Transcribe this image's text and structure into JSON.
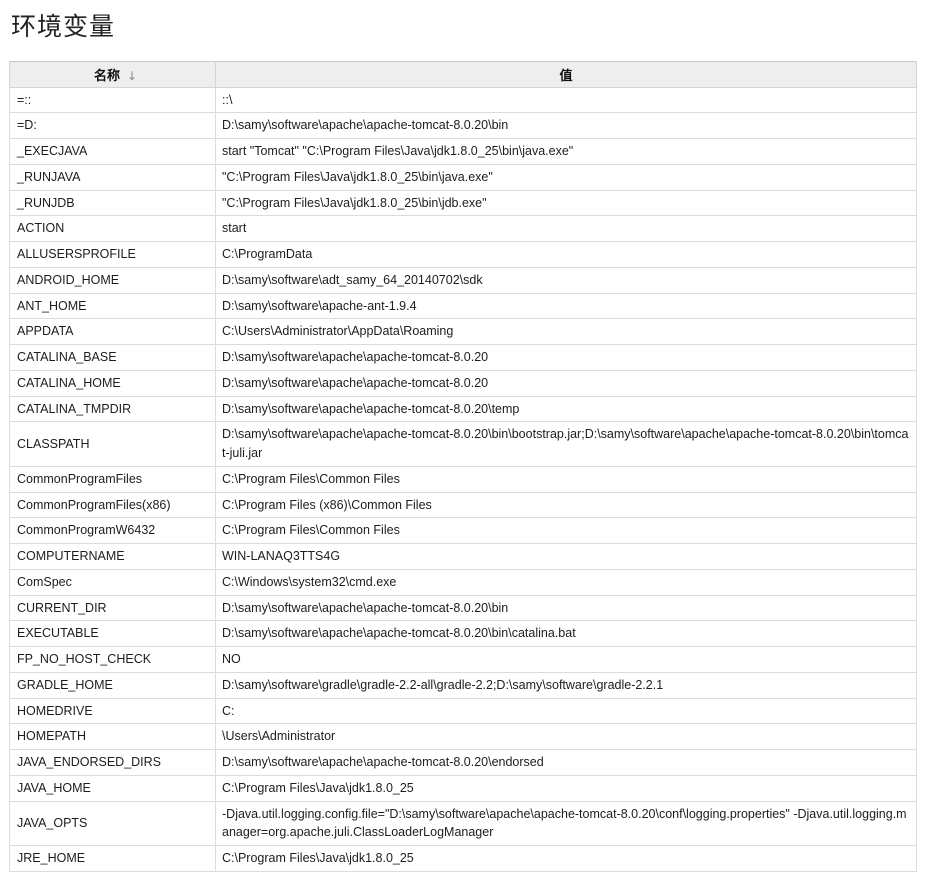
{
  "page": {
    "title": "环境变量"
  },
  "table": {
    "columns": [
      {
        "label": "名称",
        "sort_indicator": "↓",
        "sorted": true
      },
      {
        "label": "值",
        "sort_indicator": "",
        "sorted": false
      }
    ],
    "rows": [
      {
        "name": "=::",
        "value": "::\\"
      },
      {
        "name": "=D:",
        "value": "D:\\samy\\software\\apache\\apache-tomcat-8.0.20\\bin"
      },
      {
        "name": "_EXECJAVA",
        "value": "start \"Tomcat\" \"C:\\Program Files\\Java\\jdk1.8.0_25\\bin\\java.exe\""
      },
      {
        "name": "_RUNJAVA",
        "value": "\"C:\\Program Files\\Java\\jdk1.8.0_25\\bin\\java.exe\""
      },
      {
        "name": "_RUNJDB",
        "value": "\"C:\\Program Files\\Java\\jdk1.8.0_25\\bin\\jdb.exe\""
      },
      {
        "name": "ACTION",
        "value": "start"
      },
      {
        "name": "ALLUSERSPROFILE",
        "value": "C:\\ProgramData"
      },
      {
        "name": "ANDROID_HOME",
        "value": "D:\\samy\\software\\adt_samy_64_20140702\\sdk"
      },
      {
        "name": "ANT_HOME",
        "value": "D:\\samy\\software\\apache-ant-1.9.4"
      },
      {
        "name": "APPDATA",
        "value": "C:\\Users\\Administrator\\AppData\\Roaming"
      },
      {
        "name": "CATALINA_BASE",
        "value": "D:\\samy\\software\\apache\\apache-tomcat-8.0.20"
      },
      {
        "name": "CATALINA_HOME",
        "value": "D:\\samy\\software\\apache\\apache-tomcat-8.0.20"
      },
      {
        "name": "CATALINA_TMPDIR",
        "value": "D:\\samy\\software\\apache\\apache-tomcat-8.0.20\\temp"
      },
      {
        "name": "CLASSPATH",
        "value": "D:\\samy\\software\\apache\\apache-tomcat-8.0.20\\bin\\bootstrap.jar;D:\\samy\\software\\apache\\apache-tomcat-8.0.20\\bin\\tomcat-juli.jar"
      },
      {
        "name": "CommonProgramFiles",
        "value": "C:\\Program Files\\Common Files"
      },
      {
        "name": "CommonProgramFiles(x86)",
        "value": "C:\\Program Files (x86)\\Common Files"
      },
      {
        "name": "CommonProgramW6432",
        "value": "C:\\Program Files\\Common Files"
      },
      {
        "name": "COMPUTERNAME",
        "value": "WIN-LANAQ3TTS4G"
      },
      {
        "name": "ComSpec",
        "value": "C:\\Windows\\system32\\cmd.exe"
      },
      {
        "name": "CURRENT_DIR",
        "value": "D:\\samy\\software\\apache\\apache-tomcat-8.0.20\\bin"
      },
      {
        "name": "EXECUTABLE",
        "value": "D:\\samy\\software\\apache\\apache-tomcat-8.0.20\\bin\\catalina.bat"
      },
      {
        "name": "FP_NO_HOST_CHECK",
        "value": "NO"
      },
      {
        "name": "GRADLE_HOME",
        "value": "D:\\samy\\software\\gradle\\gradle-2.2-all\\gradle-2.2;D:\\samy\\software\\gradle-2.2.1"
      },
      {
        "name": "HOMEDRIVE",
        "value": "C:"
      },
      {
        "name": "HOMEPATH",
        "value": "\\Users\\Administrator"
      },
      {
        "name": "JAVA_ENDORSED_DIRS",
        "value": "D:\\samy\\software\\apache\\apache-tomcat-8.0.20\\endorsed"
      },
      {
        "name": "JAVA_HOME",
        "value": "C:\\Program Files\\Java\\jdk1.8.0_25"
      },
      {
        "name": "JAVA_OPTS",
        "value": "-Djava.util.logging.config.file=\"D:\\samy\\software\\apache\\apache-tomcat-8.0.20\\conf\\logging.properties\" -Djava.util.logging.manager=org.apache.juli.ClassLoaderLogManager"
      },
      {
        "name": "JRE_HOME",
        "value": "C:\\Program Files\\Java\\jdk1.8.0_25"
      }
    ]
  },
  "colors": {
    "header_bg": "#eeeeee",
    "border": "#dcdcdc",
    "text": "#1d1d1d",
    "title": "#222222"
  }
}
